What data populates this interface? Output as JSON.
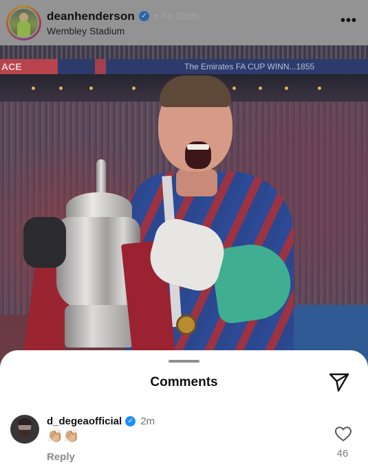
{
  "post": {
    "username": "deanhenderson",
    "faded_text": "• Fo Stats",
    "location": "Wembley Stadium",
    "more_icon": "more-horizontal-icon",
    "photo": {
      "banner_left": "ACE",
      "banner_center": "The Emirates FA CUP WINN...1855"
    }
  },
  "comments_sheet": {
    "title": "Comments",
    "share_icon": "paper-plane-icon",
    "comments": [
      {
        "username": "d_degeaofficial",
        "verified": true,
        "time": "2m",
        "text": "👏🏼👏🏼",
        "reply_label": "Reply",
        "likes": "46"
      }
    ]
  },
  "colors": {
    "verified_blue": "#1f8ff7",
    "sheet_background": "#ffffff",
    "overlay_dim": "#7a7a7a"
  }
}
